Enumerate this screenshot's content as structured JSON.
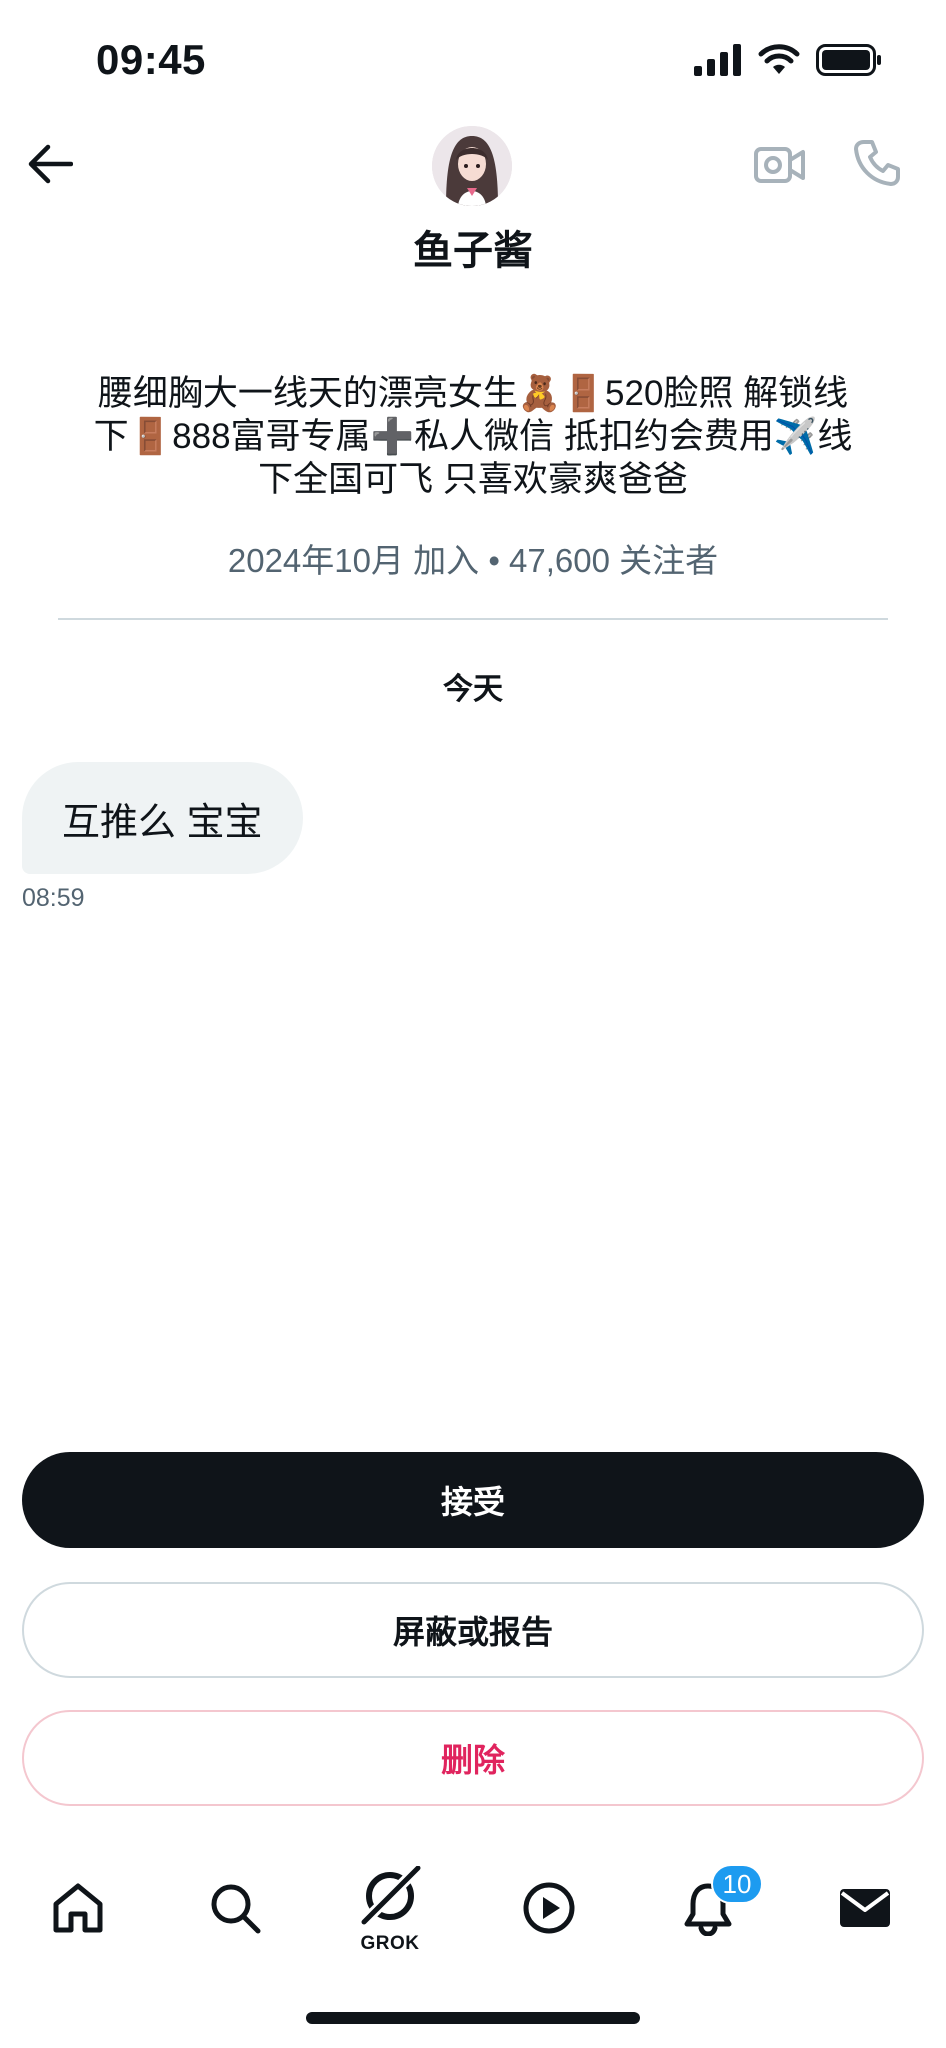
{
  "status_bar": {
    "time": "09:45"
  },
  "header": {
    "contact_name": "鱼子酱",
    "icons": [
      "arrow-left-icon",
      "video-camera-icon",
      "phone-icon"
    ]
  },
  "profile": {
    "bio_line1": "腰细胸大一线天的漂亮女生🧸🚪520脸照 解锁线",
    "bio_line2": "下🚪888富哥专属➕私人微信 抵扣约会费用✈️线",
    "bio_line3": "下全国可飞 只喜欢豪爽爸爸",
    "meta": "2024年10月 加入 • 47,600 关注者"
  },
  "conversation": {
    "date_label": "今天",
    "messages": [
      {
        "text": "互推么 宝宝",
        "time": "08:59"
      }
    ]
  },
  "actions": {
    "accept_label": "接受",
    "block_label": "屏蔽或报告",
    "delete_label": "删除"
  },
  "bottom_nav": {
    "items": [
      "home-icon",
      "search-icon",
      "grok-icon",
      "video-play-icon",
      "bell-icon",
      "mail-icon"
    ],
    "grok_label": "GROK",
    "notification_badge": "10"
  },
  "colors": {
    "primary_text": "#0f1419",
    "secondary_text": "#536471",
    "bubble_bg": "#eff3f4",
    "delete_red": "#e0245e",
    "badge_blue": "#1d9bf0"
  }
}
